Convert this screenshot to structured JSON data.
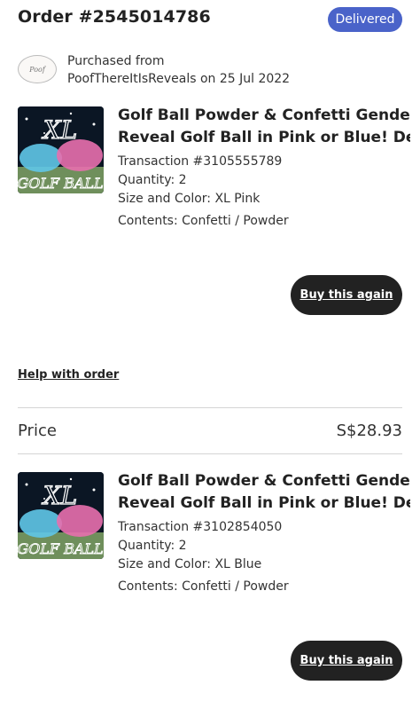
{
  "header": {
    "order_title": "Order #2545014786",
    "status_badge": "Delivered",
    "status_color": "#4a63c9"
  },
  "shop": {
    "logo_text": "Poof",
    "purchased_line1": "Purchased from",
    "purchased_line2": "PoofThereItIsReveals on 25 Jul 2022"
  },
  "items": [
    {
      "title_line1": "Golf Ball Powder & Confetti Gender",
      "title_line2": "Reveal Golf Ball in Pink or Blue! Desi...",
      "transaction": "Transaction #3105555789",
      "quantity": "Quantity: 2",
      "size_color": "Size and Color: XL Pink",
      "contents": "Contents: Confetti / Powder",
      "thumb_top": "XL",
      "thumb_bottom": "GOLF BALL",
      "buy_label": "Buy this again"
    },
    {
      "title_line1": "Golf Ball Powder & Confetti Gender",
      "title_line2": "Reveal Golf Ball in Pink or Blue! Desi...",
      "transaction": "Transaction #3102854050",
      "quantity": "Quantity: 2",
      "size_color": "Size and Color: XL Blue",
      "contents": "Contents: Confetti / Powder",
      "thumb_top": "XL",
      "thumb_bottom": "GOLF BALL",
      "buy_label": "Buy this again"
    }
  ],
  "help_link": "Help with order",
  "price": {
    "label": "Price",
    "value": "S$28.93"
  }
}
